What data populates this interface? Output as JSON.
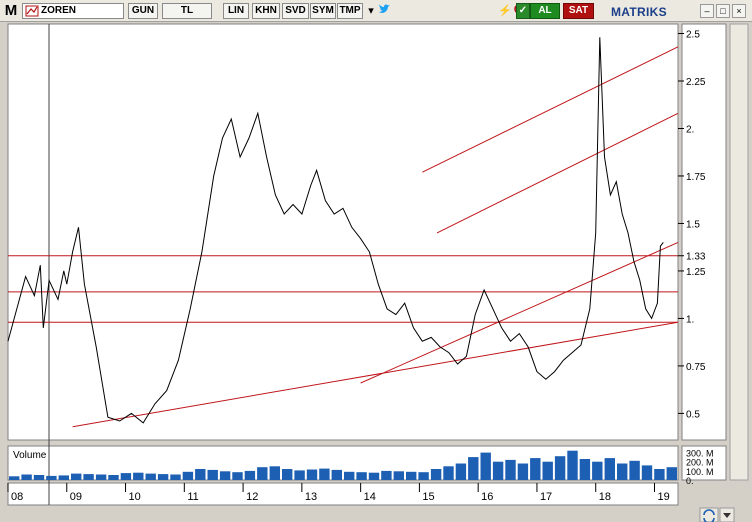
{
  "toolbar": {
    "app_logo": "M",
    "symbol": "ZOREN",
    "period_label": "GUN",
    "currency_label": "TL",
    "scale_label": "LIN",
    "btn_khn": "KHN",
    "btn_svd": "SVD",
    "btn_sym": "SYM",
    "btn_tmp": "TMP",
    "buy_label": "AL",
    "sell_label": "SAT",
    "brand": "MATRIKS",
    "colors": {
      "buy": "#1a7a1a",
      "sell": "#b01010",
      "accent": "#1c5fb3"
    }
  },
  "chart_data": {
    "type": "line",
    "price_axis": {
      "ticks": [
        "2.5",
        "2.25",
        "2.",
        "1.75",
        "1.5",
        "1.33",
        "1.25",
        "1.",
        "0.75",
        "0.5"
      ],
      "tick_values": [
        2.5,
        2.25,
        2.0,
        1.75,
        1.5,
        1.33,
        1.25,
        1.0,
        0.75,
        0.5
      ],
      "ylim": [
        0.36,
        2.55
      ]
    },
    "x_axis": {
      "labels": [
        "08",
        "09",
        "10",
        "11",
        "12",
        "13",
        "14",
        "15",
        "16",
        "17",
        "18",
        "19"
      ],
      "xlim": [
        2008.0,
        2019.4
      ]
    },
    "price_series": [
      [
        2008.0,
        0.88
      ],
      [
        2008.15,
        1.05
      ],
      [
        2008.3,
        1.22
      ],
      [
        2008.45,
        1.12
      ],
      [
        2008.55,
        1.28
      ],
      [
        2008.6,
        0.95
      ],
      [
        2008.7,
        1.2
      ],
      [
        2008.85,
        1.1
      ],
      [
        2008.95,
        1.25
      ],
      [
        2009.0,
        1.18
      ],
      [
        2009.1,
        1.35
      ],
      [
        2009.2,
        1.48
      ],
      [
        2009.3,
        1.18
      ],
      [
        2009.5,
        0.85
      ],
      [
        2009.7,
        0.48
      ],
      [
        2009.9,
        0.46
      ],
      [
        2010.1,
        0.5
      ],
      [
        2010.3,
        0.45
      ],
      [
        2010.5,
        0.55
      ],
      [
        2010.7,
        0.62
      ],
      [
        2010.9,
        0.78
      ],
      [
        2011.1,
        1.05
      ],
      [
        2011.3,
        1.35
      ],
      [
        2011.5,
        1.75
      ],
      [
        2011.65,
        1.95
      ],
      [
        2011.8,
        2.05
      ],
      [
        2011.95,
        1.85
      ],
      [
        2012.1,
        1.95
      ],
      [
        2012.25,
        2.08
      ],
      [
        2012.4,
        1.85
      ],
      [
        2012.55,
        1.65
      ],
      [
        2012.7,
        1.55
      ],
      [
        2012.85,
        1.6
      ],
      [
        2013.0,
        1.55
      ],
      [
        2013.15,
        1.7
      ],
      [
        2013.25,
        1.78
      ],
      [
        2013.4,
        1.62
      ],
      [
        2013.55,
        1.55
      ],
      [
        2013.7,
        1.58
      ],
      [
        2013.85,
        1.48
      ],
      [
        2014.0,
        1.42
      ],
      [
        2014.15,
        1.35
      ],
      [
        2014.3,
        1.18
      ],
      [
        2014.45,
        1.05
      ],
      [
        2014.6,
        1.02
      ],
      [
        2014.75,
        1.08
      ],
      [
        2014.9,
        0.95
      ],
      [
        2015.05,
        0.88
      ],
      [
        2015.2,
        0.9
      ],
      [
        2015.35,
        0.85
      ],
      [
        2015.5,
        0.82
      ],
      [
        2015.65,
        0.76
      ],
      [
        2015.8,
        0.8
      ],
      [
        2015.95,
        1.02
      ],
      [
        2016.1,
        1.15
      ],
      [
        2016.25,
        1.05
      ],
      [
        2016.4,
        0.95
      ],
      [
        2016.55,
        0.88
      ],
      [
        2016.7,
        0.92
      ],
      [
        2016.85,
        0.85
      ],
      [
        2017.0,
        0.72
      ],
      [
        2017.15,
        0.68
      ],
      [
        2017.3,
        0.72
      ],
      [
        2017.45,
        0.78
      ],
      [
        2017.6,
        0.82
      ],
      [
        2017.75,
        0.86
      ],
      [
        2017.9,
        1.05
      ],
      [
        2018.0,
        1.45
      ],
      [
        2018.07,
        2.48
      ],
      [
        2018.15,
        1.85
      ],
      [
        2018.25,
        1.65
      ],
      [
        2018.35,
        1.72
      ],
      [
        2018.45,
        1.55
      ],
      [
        2018.55,
        1.45
      ],
      [
        2018.65,
        1.3
      ],
      [
        2018.75,
        1.2
      ],
      [
        2018.85,
        1.05
      ],
      [
        2018.95,
        1.0
      ],
      [
        2019.05,
        1.08
      ],
      [
        2019.1,
        1.38
      ],
      [
        2019.15,
        1.4
      ]
    ],
    "volume_series": [
      40,
      60,
      55,
      45,
      50,
      70,
      65,
      60,
      55,
      75,
      80,
      70,
      65,
      60,
      90,
      120,
      110,
      95,
      85,
      100,
      140,
      150,
      120,
      105,
      115,
      125,
      110,
      90,
      85,
      80,
      100,
      95,
      90,
      85,
      120,
      150,
      180,
      250,
      300,
      200,
      220,
      180,
      240,
      200,
      260,
      320,
      230,
      200,
      240,
      180,
      210,
      160,
      120,
      140
    ],
    "volume_axis": {
      "ticks": [
        "300. M",
        "200. M",
        "100. M",
        "0."
      ],
      "tick_values": [
        300,
        200,
        100,
        0
      ]
    },
    "volume_label": "Volume",
    "horizontal_levels": [
      1.33,
      1.14,
      0.98
    ],
    "trendlines": [
      {
        "from": [
          2009.1,
          0.43
        ],
        "to": [
          2019.4,
          0.98
        ]
      },
      {
        "from": [
          2014.0,
          0.66
        ],
        "to": [
          2019.4,
          1.4
        ]
      },
      {
        "from": [
          2015.05,
          1.77
        ],
        "to": [
          2019.4,
          2.43
        ]
      },
      {
        "from": [
          2015.3,
          1.45
        ],
        "to": [
          2019.4,
          2.08
        ]
      }
    ],
    "grid": false,
    "colors": {
      "price": "#000000",
      "volume": "#1c5fb3",
      "lines": "#c0151a",
      "grid": "#d8d8d8"
    }
  }
}
